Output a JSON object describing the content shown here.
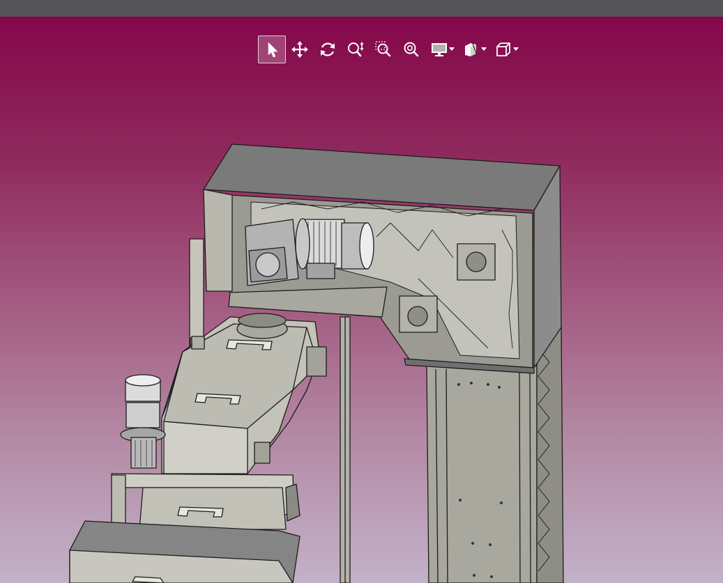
{
  "app": {
    "window": "3D CAD viewer",
    "accent_color": "#8a0c45",
    "toolbar_background": "#555557"
  },
  "toolbar": {
    "buttons": [
      {
        "name": "select-tool",
        "icon": "cursor-arrow-icon",
        "active": true
      },
      {
        "name": "pan-tool",
        "icon": "move-arrows-icon",
        "active": false
      },
      {
        "name": "rotate-tool",
        "icon": "rotate-icon",
        "active": false
      },
      {
        "name": "zoom-tool",
        "icon": "zoom-updown-icon",
        "active": false
      },
      {
        "name": "zoom-window-tool",
        "icon": "zoom-window-icon",
        "active": false
      },
      {
        "name": "zoom-fit-tool",
        "icon": "zoom-fit-icon",
        "active": false
      },
      {
        "name": "display-mode-menu",
        "icon": "monitor-icon",
        "dropdown": true
      },
      {
        "name": "section-menu",
        "icon": "section-cube-icon",
        "dropdown": true
      },
      {
        "name": "view-orientation-menu",
        "icon": "cube-icon",
        "dropdown": true
      }
    ]
  },
  "viewport": {
    "content": "conveyor-elevator-assembly-model",
    "part_colors": {
      "sheet_metal": "#a9a89e",
      "dark_face": "#6e6e6e",
      "edge": "#1c1c1c",
      "motor_steel": "#cfcfcf"
    }
  }
}
